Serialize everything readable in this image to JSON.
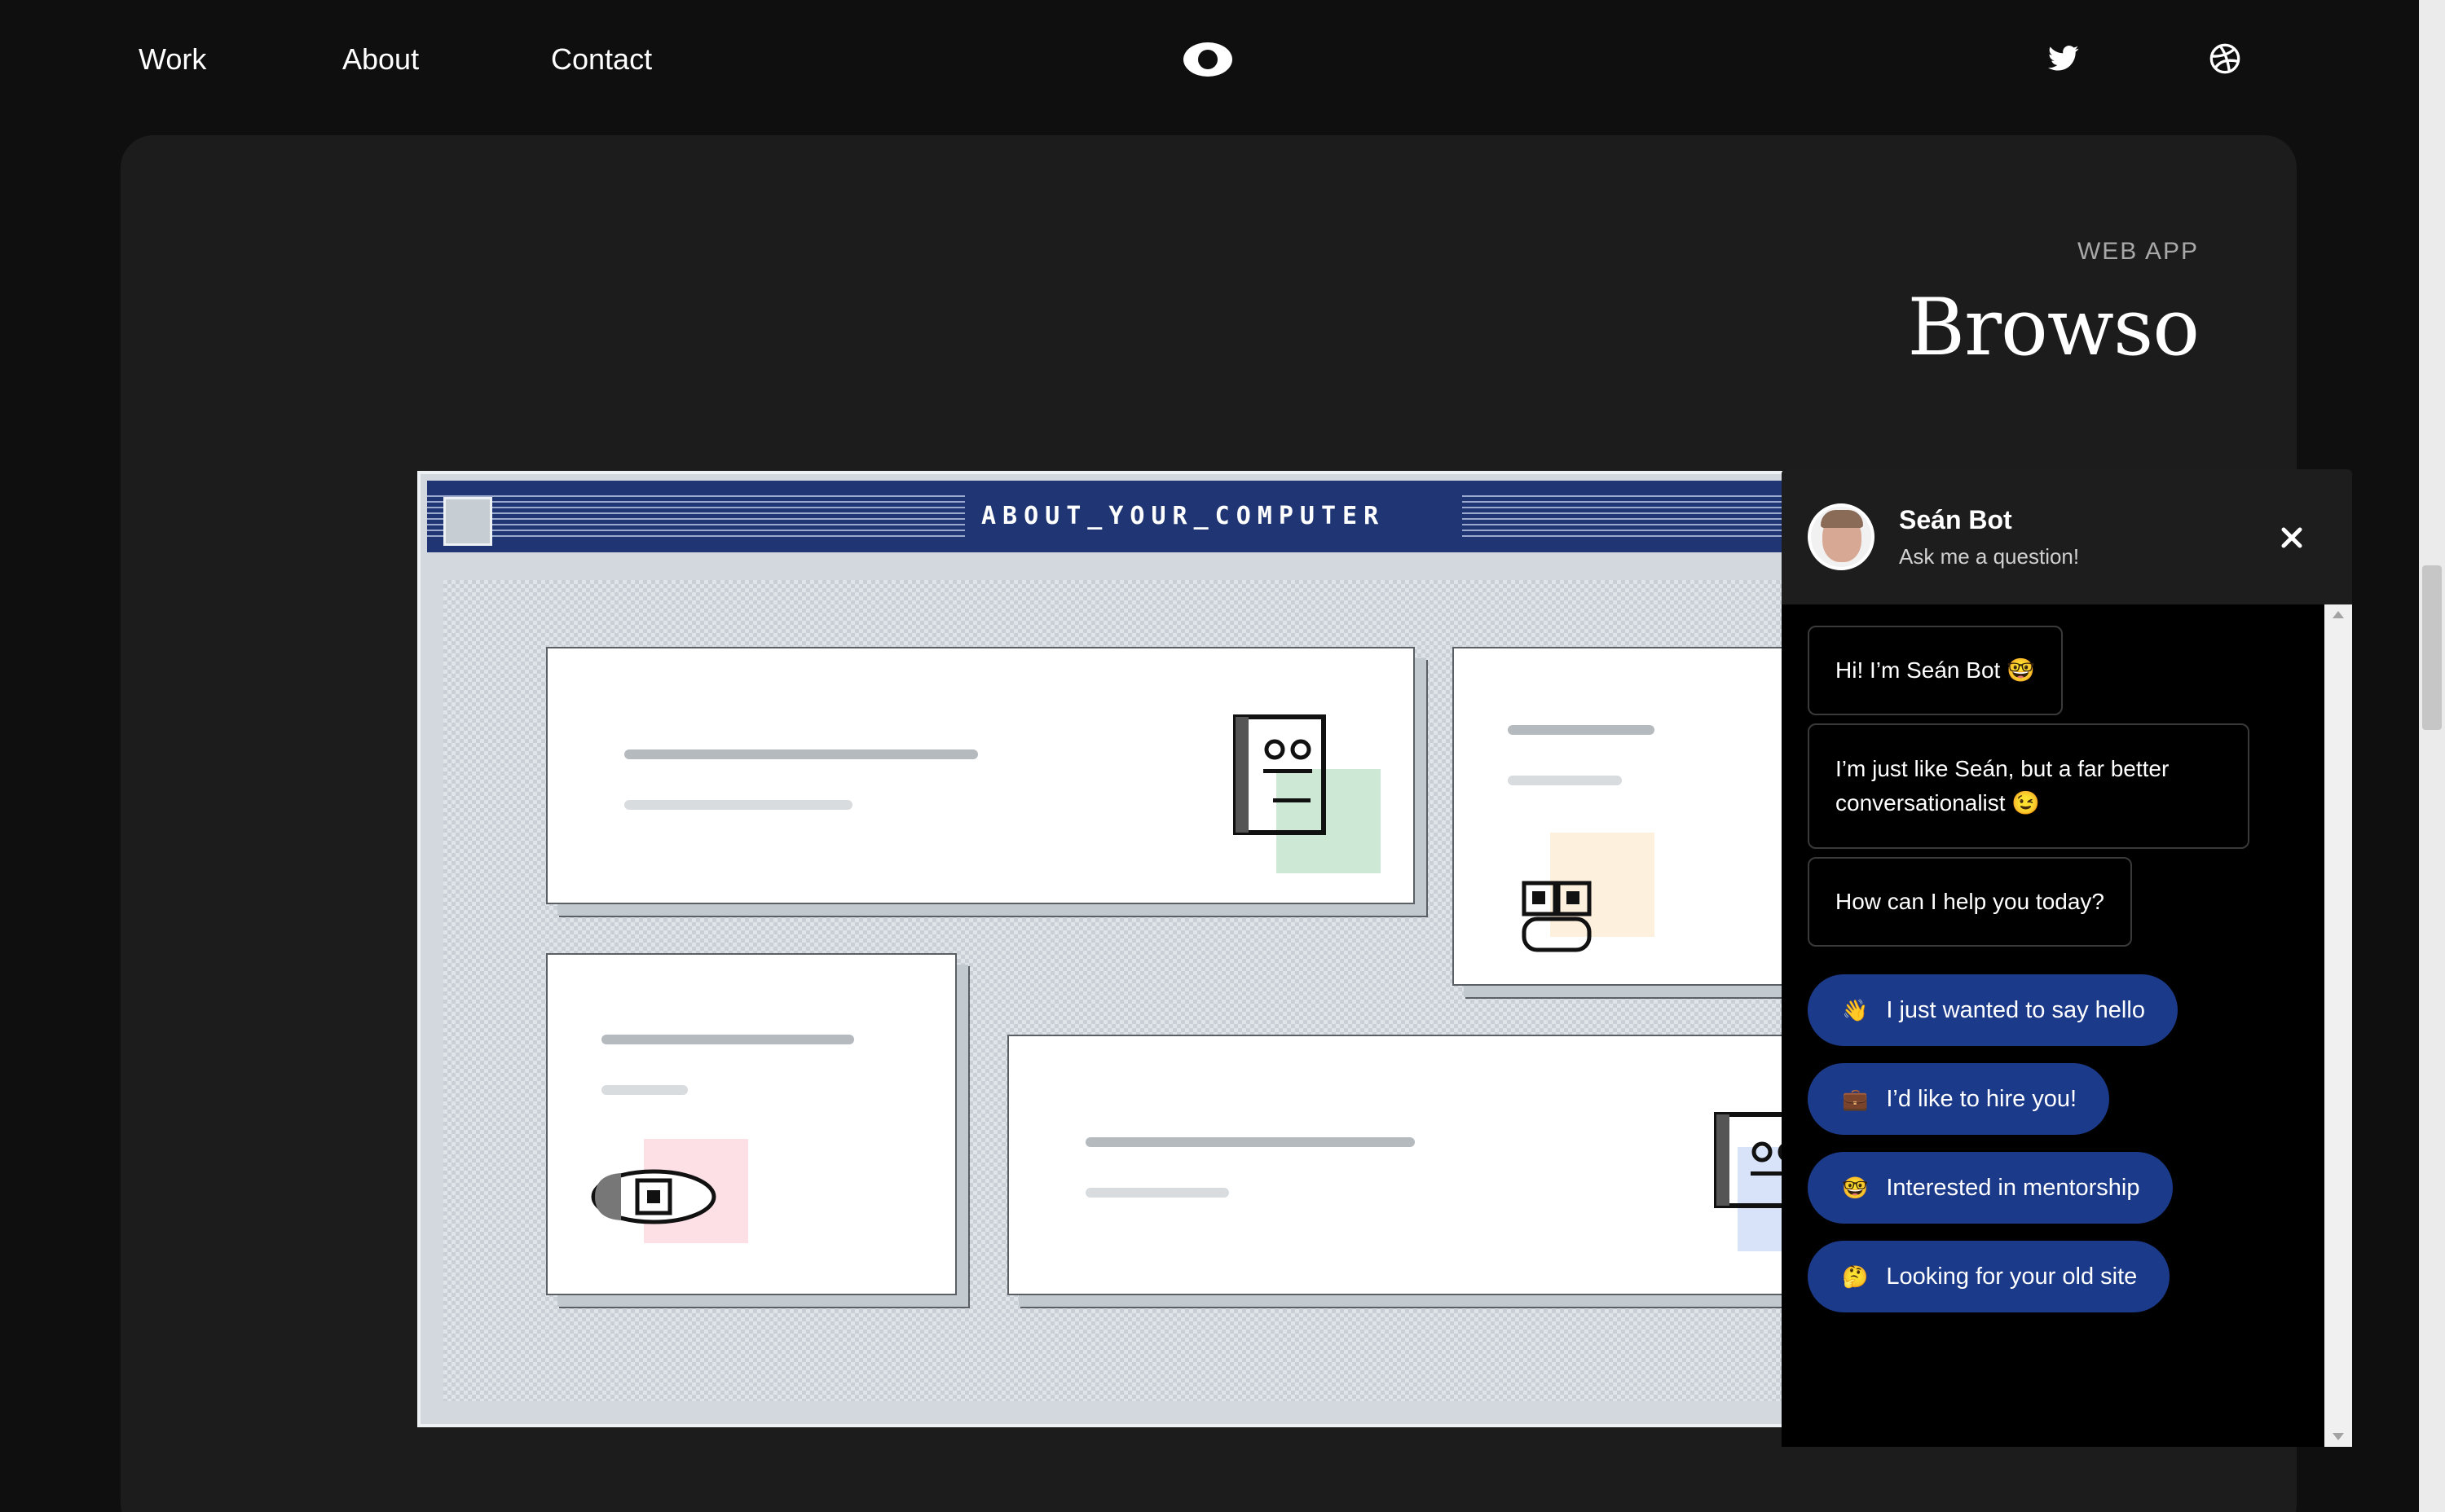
{
  "nav": {
    "links": [
      "Work",
      "About",
      "Contact"
    ],
    "logo_icon": "eye-logo",
    "social_icons": [
      "twitter-icon",
      "dribbble-icon"
    ]
  },
  "project": {
    "category": "WEB APP",
    "title": "Browso"
  },
  "retro_window": {
    "title": "ABOUT_YOUR_COMPUTER"
  },
  "chat": {
    "bot_name": "Seán Bot",
    "subtitle": "Ask me a question!",
    "messages": [
      "Hi! I’m Seán Bot 🤓",
      "I’m just like Seán, but a far better conversationalist 😉",
      "How can I help you today?"
    ],
    "quick_replies": [
      {
        "emoji": "👋",
        "label": "I just wanted to say hello"
      },
      {
        "emoji": "💼",
        "label": "I’d like to hire you!"
      },
      {
        "emoji": "🤓",
        "label": "Interested in mentorship"
      },
      {
        "emoji": "🤔",
        "label": "Looking for your old site"
      }
    ]
  },
  "colors": {
    "page_bg": "#0f0f0f",
    "card_bg": "#1c1c1c",
    "retro_titlebar": "#1f3574",
    "quick_reply_bg": "#1c3a8a"
  }
}
